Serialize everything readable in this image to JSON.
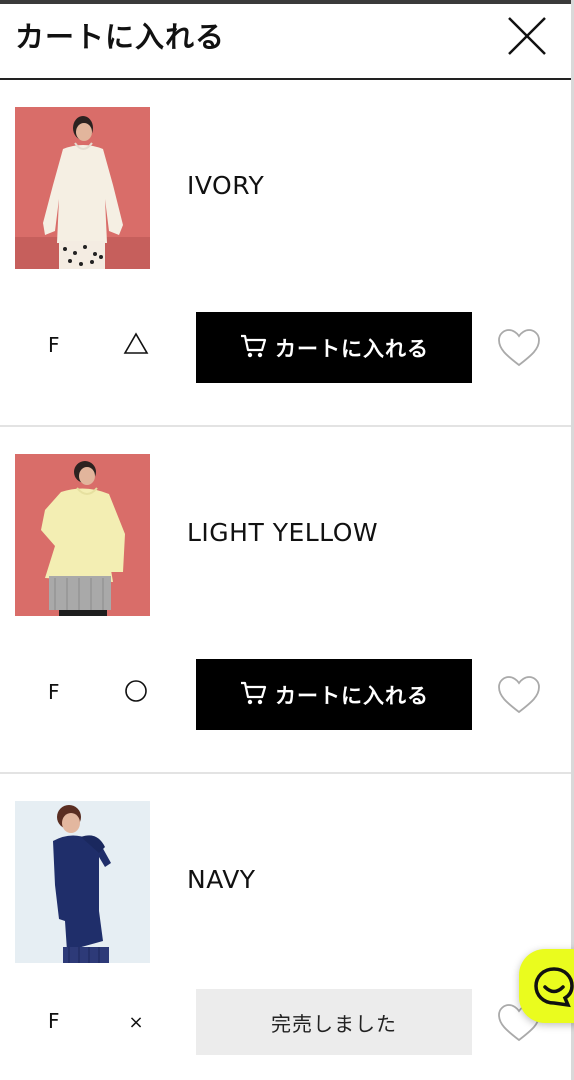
{
  "header": {
    "title": "カートに入れる"
  },
  "items": [
    {
      "color": "IVORY",
      "size": "F",
      "stock_symbol": "△",
      "button": "カートに入れる",
      "image": "model-ivory-hoodie"
    },
    {
      "color": "LIGHT YELLOW",
      "size": "F",
      "stock_symbol": "○",
      "button": "カートに入れる",
      "image": "model-light-yellow-hoodie"
    },
    {
      "color": "NAVY",
      "size": "F",
      "stock_symbol": "×",
      "button": "完売しました",
      "image": "model-navy-hoodie"
    }
  ],
  "icons": {
    "close": "close-icon",
    "cart": "cart-icon",
    "favorite": "heart-icon",
    "chat": "chat-icon"
  },
  "colors": {
    "accent": "#000000",
    "chat_button": "#eafc1e",
    "soldout_bg": "#ececec",
    "photo_bg_warm": "#d96d69",
    "photo_bg_cool": "#e6eef3"
  }
}
